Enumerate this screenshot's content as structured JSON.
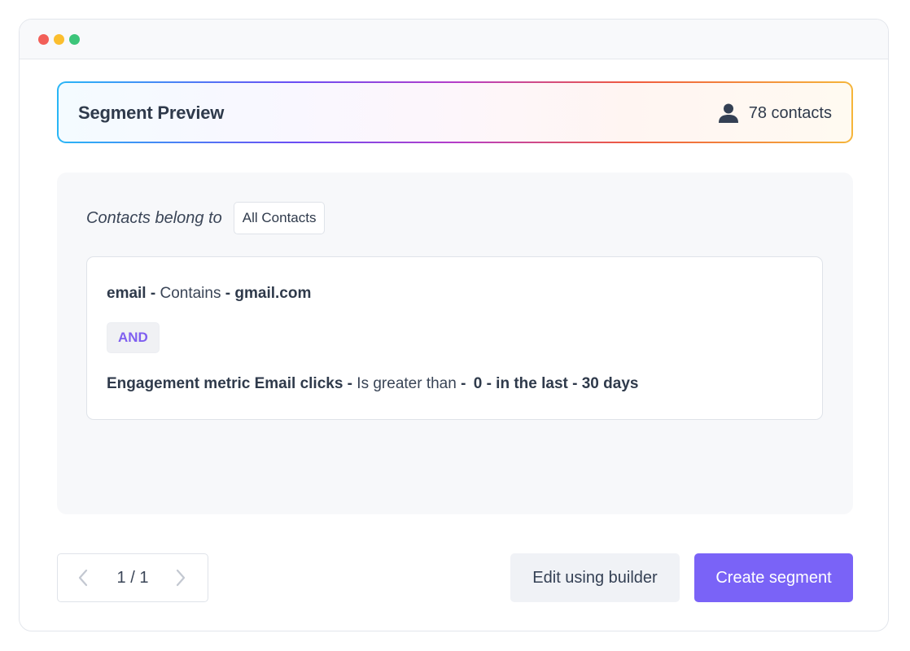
{
  "window": {
    "controls": [
      "close",
      "minimize",
      "maximize"
    ]
  },
  "header": {
    "title": "Segment Preview",
    "contacts_label": "78 contacts",
    "contacts_icon": "user-icon"
  },
  "segment": {
    "belong_label": "Contacts belong to",
    "belong_value": "All Contacts",
    "conditions": [
      {
        "field": "email",
        "sep1": " - ",
        "operator": "Contains",
        "sep2": " - ",
        "value": "gmail.com"
      },
      {
        "field": "Engagement metric Email clicks",
        "sep1": " - ",
        "operator": "Is greater than",
        "sep2": " - ",
        "value": "0 - in the last - 30 days"
      }
    ],
    "joiner": "AND"
  },
  "footer": {
    "pagination": "1 / 1",
    "edit_label": "Edit using builder",
    "create_label": "Create segment"
  },
  "colors": {
    "accent": "#7a63f7",
    "and_text": "#7f5ff0",
    "gradient": [
      "#29b6f6",
      "#6a4df4",
      "#b43dc9",
      "#ef5a3e",
      "#f5b53a"
    ]
  }
}
